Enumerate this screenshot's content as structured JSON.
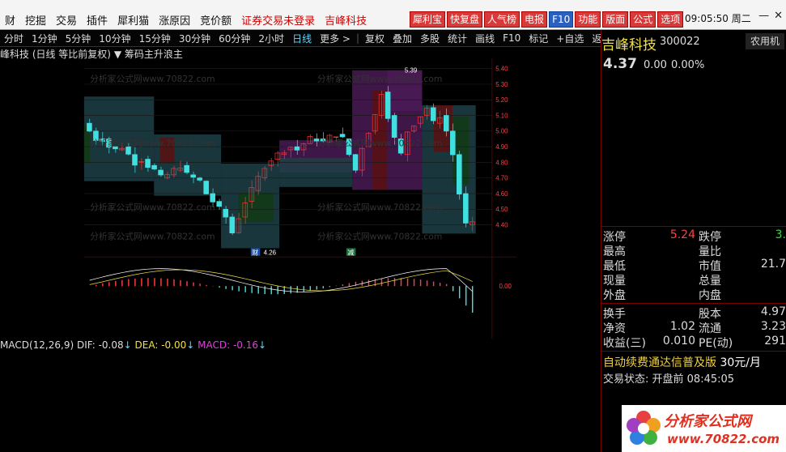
{
  "app": {
    "menu": [
      "财",
      "挖掘",
      "交易",
      "插件",
      "犀利猫",
      "涨原因",
      "竞价额"
    ],
    "menu_red": [
      "证券交易未登录",
      "吉峰科技"
    ],
    "top_buttons": [
      "犀利宝",
      "快复盘",
      "人气榜",
      "电报",
      "F10",
      "功能",
      "版面",
      "公式",
      "选项"
    ],
    "clock": "09:05:50 周二"
  },
  "toolbar": {
    "items": [
      "分时",
      "1分钟",
      "5分钟",
      "10分钟",
      "15分钟",
      "30分钟",
      "60分钟",
      "2小时",
      "日线",
      "更多 >",
      "复权",
      "叠加",
      "多股",
      "统计",
      "画线",
      "F10",
      "标记",
      "+自选",
      "返回"
    ],
    "selected": "日线"
  },
  "chart": {
    "title": "峰科技 (日线 等比前复权)",
    "indicator": "筹码主升浪主",
    "ylabels": [
      "5.40",
      "5.30",
      "5.20",
      "5.10",
      "5.00",
      "4.90",
      "4.80",
      "4.70",
      "4.60",
      "4.50",
      "4.40"
    ],
    "high_label": "5.39",
    "low_label": "4.26",
    "marker1": "财",
    "marker2": "减",
    "macd_title": "MACD(12,26,9)",
    "dif": "DIF: -0.08",
    "dea": "DEA: -0.00",
    "macd": "MACD: -0.16",
    "macd_zero": "0.00",
    "watermark": "分析家公式网www.70822.com"
  },
  "quote": {
    "name": "吉峰科技",
    "code": "300022",
    "tab": "农用机",
    "price": "4.37",
    "change": "0.00",
    "pct": "0.00%",
    "rows": [
      {
        "l1": "涨停",
        "v1": "5.24",
        "l2": "跌停",
        "v2": "3."
      },
      {
        "l1": "最高",
        "v1": "",
        "l2": "量比",
        "v2": ""
      },
      {
        "l1": "最低",
        "v1": "",
        "l2": "市值",
        "v2": "21.7"
      },
      {
        "l1": "现量",
        "v1": "",
        "l2": "总量",
        "v2": ""
      },
      {
        "l1": "外盘",
        "v1": "",
        "l2": "内盘",
        "v2": ""
      },
      {
        "l1": "换手",
        "v1": "",
        "l2": "股本",
        "v2": "4.97"
      },
      {
        "l1": "净资",
        "v1": "1.02",
        "l2": "流通",
        "v2": "3.23"
      },
      {
        "l1": "收益(三)",
        "v1": "0.010",
        "l2": "PE(动)",
        "v2": "291"
      }
    ],
    "promo": "自动续费通达信普及版",
    "promo_price": "30元/月",
    "status_label": "交易状态: 开盘前",
    "status_time": "08:45:05"
  },
  "logo": {
    "text": "分析家公式网",
    "url": "www.70822.com"
  }
}
